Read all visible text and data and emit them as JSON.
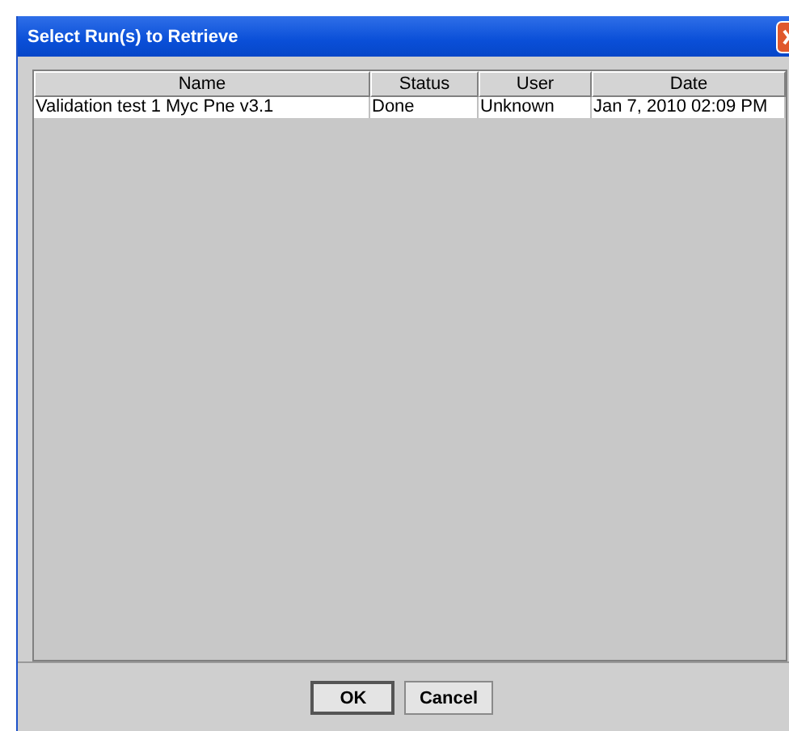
{
  "window": {
    "title": "Select Run(s) to Retrieve"
  },
  "table": {
    "columns": [
      "Name",
      "Status",
      "User",
      "Date"
    ],
    "rows": [
      {
        "selected": false,
        "cells": [
          "Validation test 1 Myc Pne v3.1",
          "Done",
          "Unknown",
          "Jan 7, 2010 02:09 PM"
        ]
      }
    ]
  },
  "buttons": [
    {
      "label": "OK",
      "default": true
    },
    {
      "label": "Cancel",
      "default": false
    }
  ]
}
